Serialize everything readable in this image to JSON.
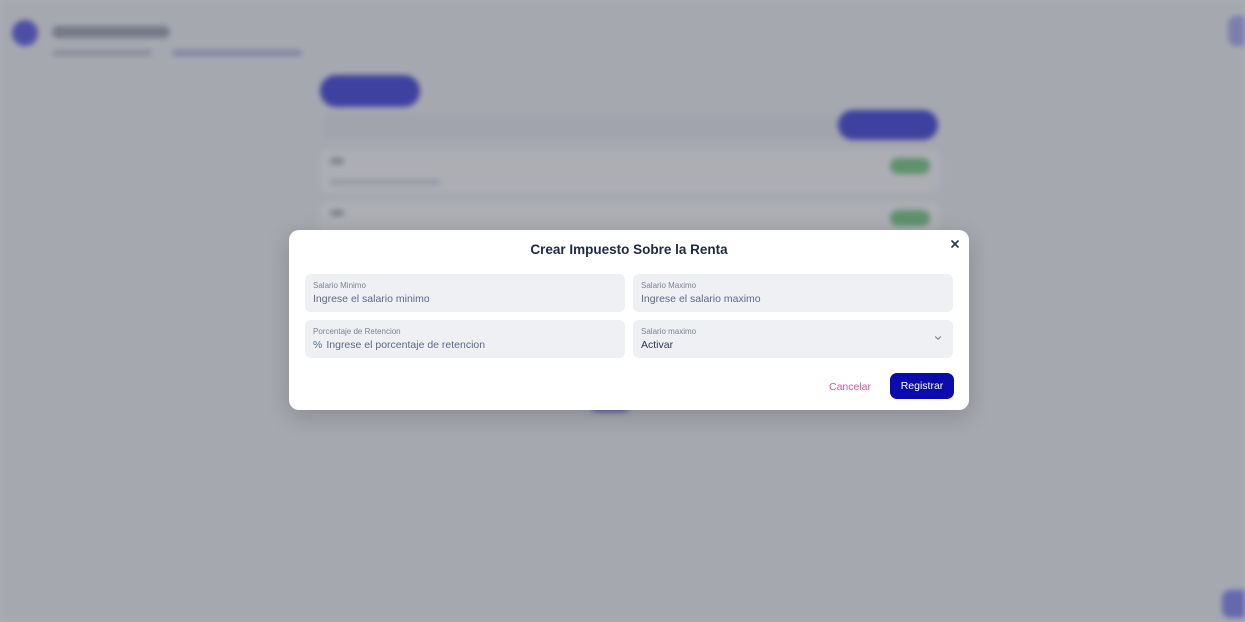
{
  "colors": {
    "primary": "#0c0cab",
    "cancel": "#e0529e",
    "overlay": "#5f6370",
    "field_bg": "#eff0f4"
  },
  "modal": {
    "title": "Crear Impuesto Sobre la Renta",
    "close_icon": "close-icon",
    "fields": {
      "salario_minimo": {
        "label": "Salario Minimo",
        "placeholder": "Ingrese el salario minimo"
      },
      "salario_maximo": {
        "label": "Salario Maximo",
        "placeholder": "Ingrese el salario maximo"
      },
      "porcentaje": {
        "label": "Porcentaje de Retencion",
        "prefix": "%",
        "placeholder": "Ingrese el porcentaje de retencion"
      },
      "salario_max_select": {
        "label": "Salario maximo",
        "value": "Activar",
        "icon": "chevron-down-icon"
      }
    },
    "actions": {
      "cancel": "Cancelar",
      "submit": "Registrar"
    }
  }
}
